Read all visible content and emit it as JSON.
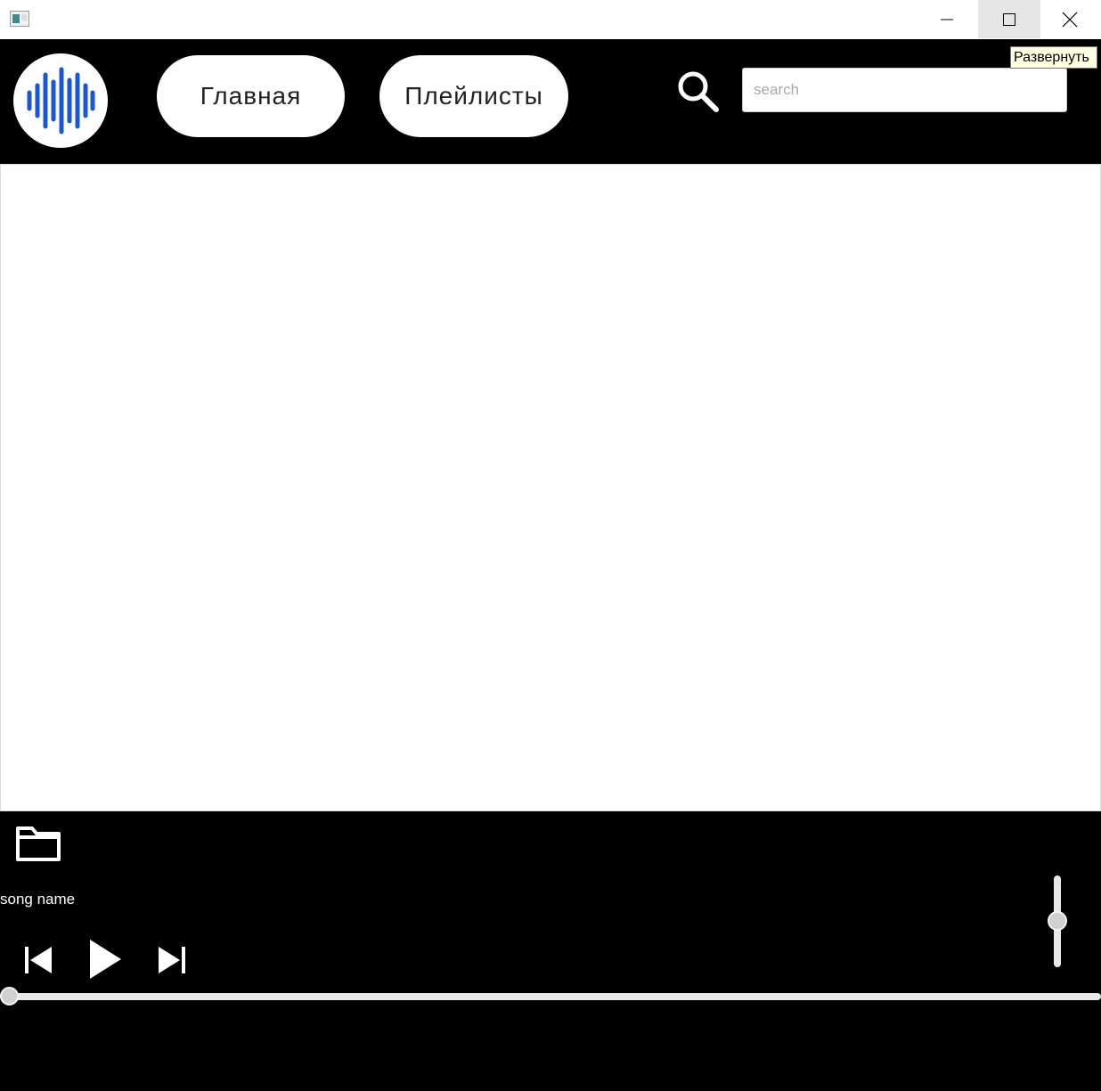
{
  "window": {
    "tooltip": "Развернуть"
  },
  "nav": {
    "home_label": "Главная",
    "playlists_label": "Плейлисты"
  },
  "search": {
    "placeholder": "search",
    "value": ""
  },
  "player": {
    "song_name": "song name",
    "volume_level": 0.5,
    "seek_position": 0
  },
  "icons": {
    "logo": "soundwave-logo-icon",
    "search": "search-icon",
    "folder": "folder-icon",
    "prev": "skip-previous-icon",
    "play": "play-icon",
    "next": "skip-next-icon"
  },
  "colors": {
    "accent": "#1a56d6",
    "background": "#000000",
    "content": "#ffffff"
  }
}
